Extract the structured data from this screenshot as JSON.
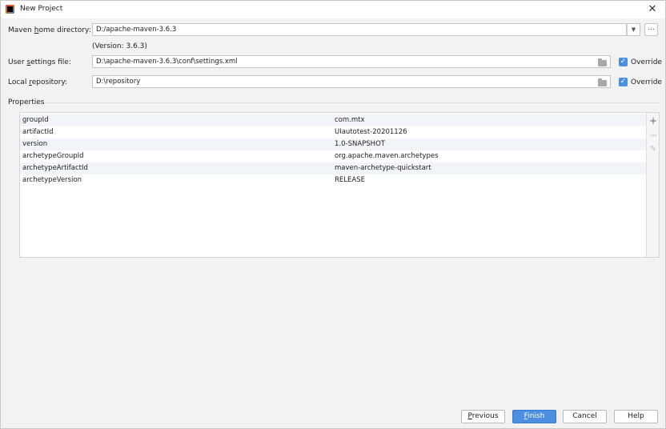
{
  "window": {
    "title": "New Project",
    "close_glyph": "✕"
  },
  "maven_home": {
    "label_prefix": "Maven ",
    "label_mnemonic": "h",
    "label_suffix": "ome directory:",
    "value": "D:/apache-maven-3.6.3",
    "version_text": "(Version: 3.6.3)",
    "dropdown_glyph": "▼",
    "browse_label": "..."
  },
  "user_settings": {
    "label_prefix": "User ",
    "label_mnemonic": "s",
    "label_suffix": "ettings file:",
    "value": "D:\\apache-maven-3.6.3\\conf\\settings.xml",
    "override_label": "Override",
    "override_checked": true
  },
  "local_repository": {
    "label_prefix": "Local ",
    "label_mnemonic": "r",
    "label_suffix": "epository:",
    "value": "D:\\repository",
    "override_label": "Override",
    "override_checked": true
  },
  "properties": {
    "title": "Properties",
    "rows": [
      {
        "key": "groupId",
        "value": "com.mtx"
      },
      {
        "key": "artifactId",
        "value": "UIautotest-20201126"
      },
      {
        "key": "version",
        "value": "1.0-SNAPSHOT"
      },
      {
        "key": "archetypeGroupId",
        "value": "org.apache.maven.archetypes"
      },
      {
        "key": "archetypeArtifactId",
        "value": "maven-archetype-quickstart"
      },
      {
        "key": "archetypeVersion",
        "value": "RELEASE"
      }
    ],
    "toolbar": {
      "add_glyph": "+",
      "remove_glyph": "−",
      "edit_glyph": "✎"
    }
  },
  "buttons": {
    "previous_mnemonic": "P",
    "previous_rest": "revious",
    "finish_mnemonic": "F",
    "finish_rest": "inish",
    "cancel": "Cancel",
    "help": "Help"
  },
  "checkmark_glyph": "✓",
  "colors": {
    "accent": "#4c8fe0",
    "row_alt": "#f1f4f9",
    "background": "#f2f2f2"
  }
}
